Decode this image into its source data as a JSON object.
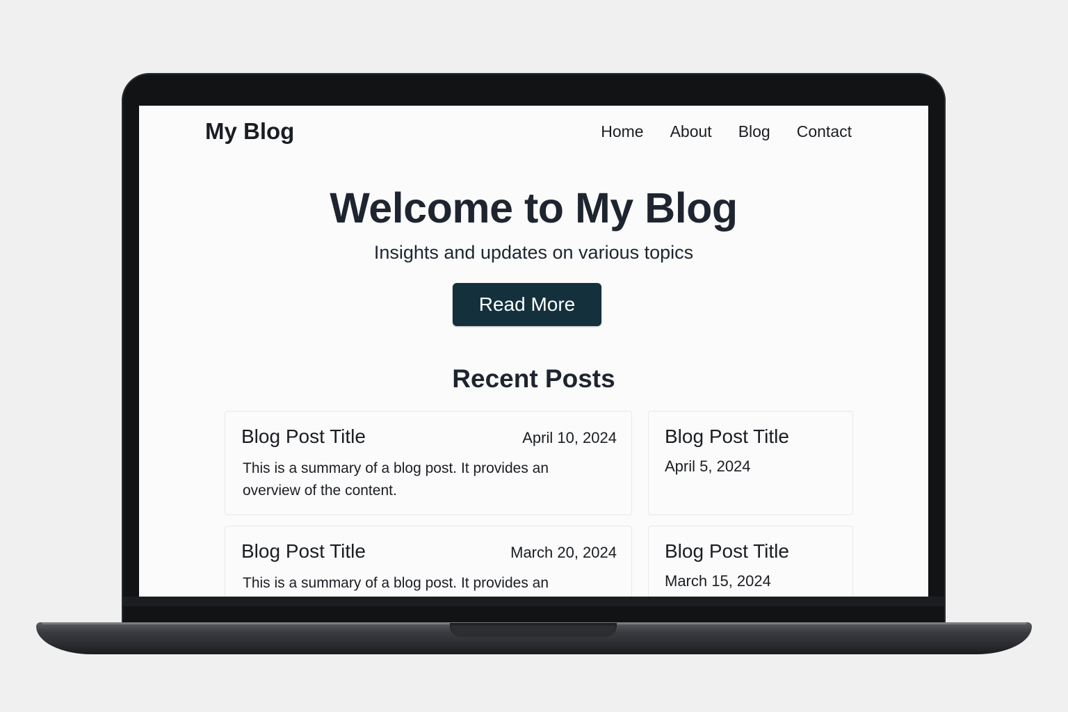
{
  "site": {
    "logo": "My Blog",
    "nav": [
      "Home",
      "About",
      "Blog",
      "Contact"
    ]
  },
  "hero": {
    "title": "Welcome to My Blog",
    "subtitle": "Insights and updates on various topics",
    "button": "Read More"
  },
  "recent": {
    "heading": "Recent Posts",
    "posts": [
      {
        "title": "Blog Post Title",
        "date": "April 10, 2024",
        "summary": "This is a summary of a blog post. It provides an overview of the content."
      },
      {
        "title": "Blog Post Title",
        "date": "April 5, 2024"
      },
      {
        "title": "Blog Post Title",
        "date": "March 20, 2024",
        "summary": "This is a summary of a blog post. It provides an"
      },
      {
        "title": "Blog Post Title",
        "date": "March 15, 2024"
      }
    ]
  },
  "colors": {
    "button_bg": "#14303d",
    "text": "#1e2530",
    "page_bg": "#fbfbfb"
  }
}
